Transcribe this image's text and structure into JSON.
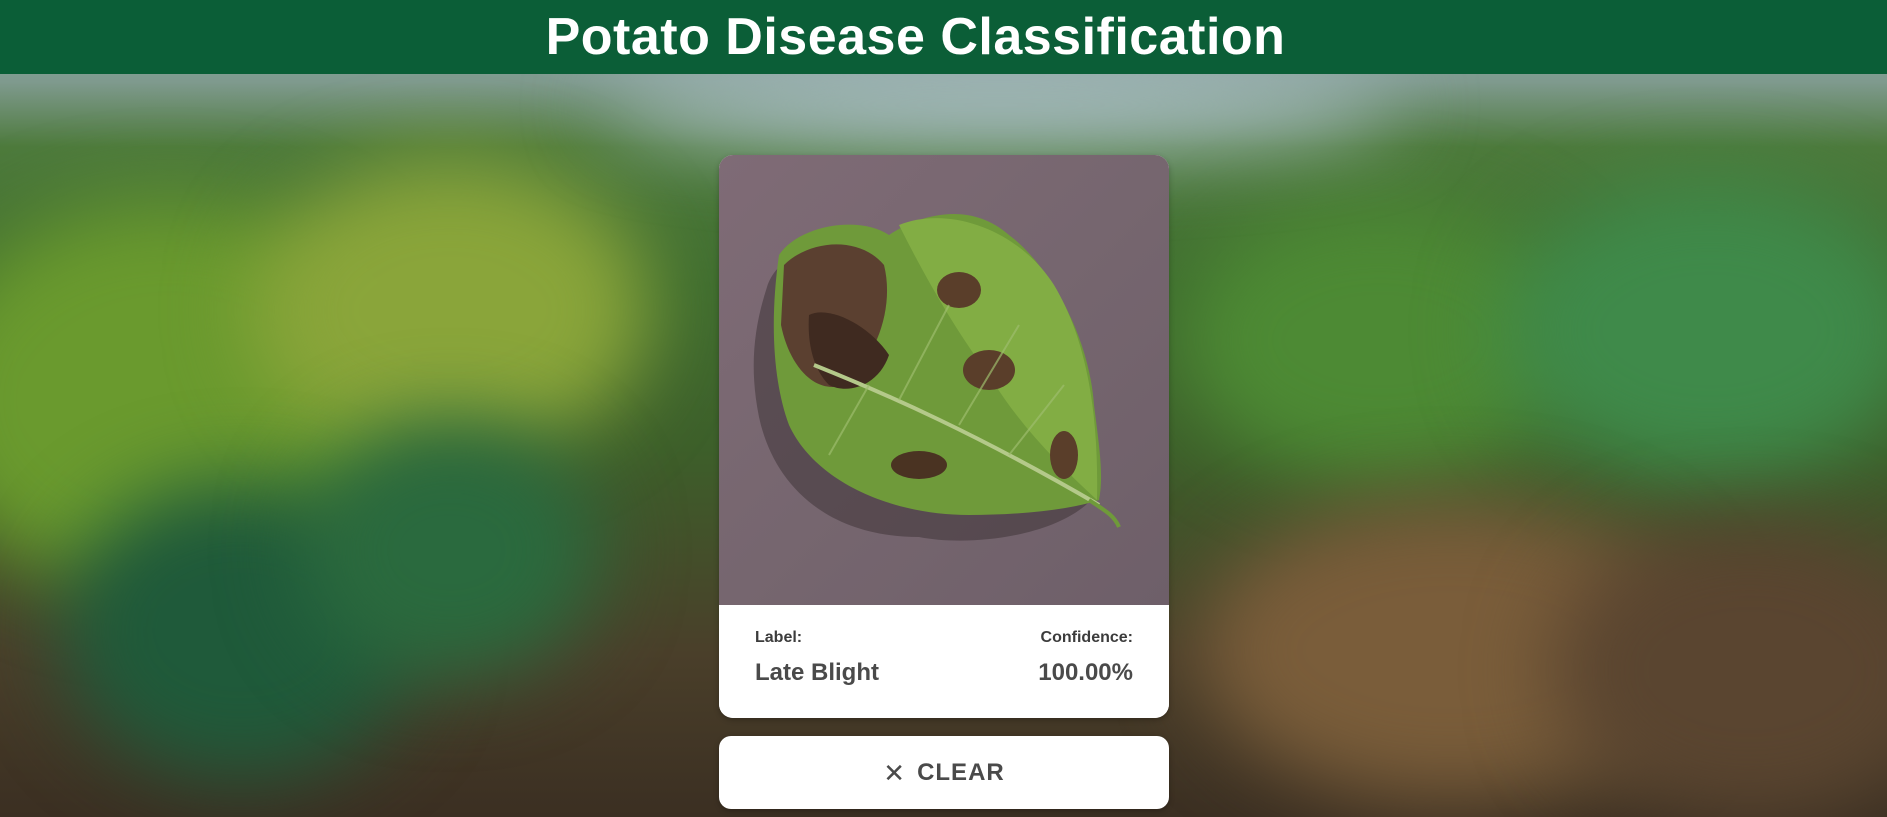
{
  "header": {
    "title": "Potato Disease Classification"
  },
  "result": {
    "label_caption": "Label:",
    "label_value": "Late Blight",
    "confidence_caption": "Confidence:",
    "confidence_value": "100.00%"
  },
  "clear_button": {
    "icon": "close-icon",
    "label": "CLEAR"
  },
  "colors": {
    "header_bg": "#0b5e37",
    "card_bg": "#ffffff",
    "text": "#4a4a4a"
  },
  "image": {
    "subject": "potato-leaf"
  }
}
